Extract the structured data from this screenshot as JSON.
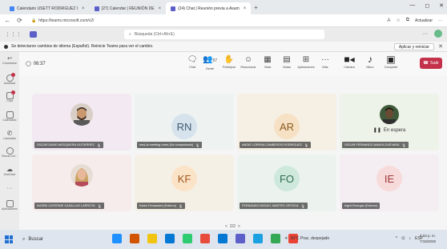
{
  "browser": {
    "tabs": [
      {
        "label": "Calendario USETT RODRIGUEZ I",
        "favicon_color": "#4285f4"
      },
      {
        "label": "(27) Calendar | REUNIÓN DE",
        "favicon_color": "#5b5fc7"
      },
      {
        "label": "(24) Chat | Reunión previa a Asam",
        "favicon_color": "#5b5fc7"
      }
    ],
    "tab_close": "×",
    "new_tab": "+",
    "window_controls": [
      "—",
      "◻",
      "✕"
    ],
    "url": "https://teams.microsoft.com/v2/",
    "update_label": "Actualizar"
  },
  "teams_header": {
    "search_placeholder": "Búsqueda (Ctrl+Alt+E)",
    "more": "···"
  },
  "banner": {
    "text": "Se detectaron cambios de idioma (Español). Reinicie Teams para ver el cambio.",
    "button": "Aplicar y reiniciar",
    "close": "✕"
  },
  "rail": {
    "items": [
      {
        "label": "Conectarse",
        "icon": "arrow-icon"
      },
      {
        "label": "Actividad",
        "icon": "bell-icon",
        "badge": true
      },
      {
        "label": "Chat",
        "icon": "chat-icon",
        "badge": true
      },
      {
        "label": "Calendario",
        "icon": "calendar-icon"
      },
      {
        "label": "Llamadas",
        "icon": "phone-icon"
      },
      {
        "label": "Bonus Dot...",
        "icon": "app-icon"
      },
      {
        "label": "OneDrive",
        "icon": "cloud-icon"
      },
      {
        "label": "···",
        "icon": "more-icon"
      },
      {
        "label": "Aplicaciones",
        "icon": "apps-icon"
      }
    ]
  },
  "meeting": {
    "timer": "06:37",
    "controls": [
      {
        "label": "Chat",
        "glyph": "🗨",
        "name": "chat-control"
      },
      {
        "label": "Gente",
        "glyph": "👥",
        "count": "57",
        "name": "people-control"
      },
      {
        "label": "Participar",
        "glyph": "✋",
        "name": "raise-control"
      },
      {
        "label": "Reaccionar",
        "glyph": "☺",
        "name": "react-control"
      },
      {
        "label": "Vista",
        "glyph": "▦",
        "name": "view-control"
      },
      {
        "label": "Notas",
        "glyph": "▤",
        "name": "notes-control"
      },
      {
        "label": "Aplicaciones",
        "glyph": "⊞",
        "name": "apps-control"
      },
      {
        "label": "Más",
        "glyph": "···",
        "name": "more-control"
      },
      {
        "label": "Cámara",
        "glyph": "📹",
        "name": "camera-control"
      },
      {
        "label": "Micro",
        "glyph": "🎙",
        "name": "mic-control"
      },
      {
        "label": "Compartir",
        "glyph": "⬆",
        "name": "share-control"
      }
    ],
    "leave_label": "Salir"
  },
  "participants": [
    {
      "name": "OSCAR DAVID MOSQUERA GUTIERREZ",
      "type": "photo",
      "bg": "#f2e9f3",
      "photo": "man-beard"
    },
    {
      "name": "med-ai meeting notes (No comprobado)",
      "type": "initials",
      "initials": "RN",
      "bg": "#eef3f1",
      "avatar_bg": "#d6e3ec",
      "avatar_fg": "#3d5a73"
    },
    {
      "name": "ANGIE LORENA CAMBEROS RODRIGUEZ",
      "type": "initials",
      "initials": "AR",
      "bg": "#f6efe4",
      "avatar_bg": "#f7e1c4",
      "avatar_fg": "#8a5a1f"
    },
    {
      "name": "OSCAR FERNANDO AMAYA GUEVARA",
      "type": "waiting",
      "waiting_label": "En espera",
      "bg": "#eef3ea",
      "photo": "man-dark"
    },
    {
      "name": "INGRID CATERINE CASALLAS LARROTA",
      "type": "photo",
      "bg": "#f6ecec",
      "photo": "woman-blonde"
    },
    {
      "name": "Karen Fernandes (Externo)",
      "type": "initials",
      "initials": "KF",
      "bg": "#f5f0e6",
      "avatar_bg": "#fbe3c8",
      "avatar_fg": "#a0581a"
    },
    {
      "name": "FERNANDO MIGUEL MARTES ORTEGA",
      "type": "initials",
      "initials": "FO",
      "bg": "#ecf3ef",
      "avatar_bg": "#cfe8dc",
      "avatar_fg": "#2d6b4f"
    },
    {
      "name": "Ingrid Energas (Externo)",
      "type": "initials",
      "initials": "IE",
      "bg": "#f4eef3",
      "avatar_bg": "#f7dada",
      "avatar_fg": "#a03a3a"
    }
  ],
  "pager": {
    "prev": "<",
    "text": "2/2",
    "next": ">"
  },
  "taskbar": {
    "search_label": "Buscar",
    "weather": "30°C Prac. despejado",
    "tray": "ESP",
    "time": "5:03 p. m.",
    "date": "7/18/2025",
    "apps": [
      "#1e90ff",
      "#d35400",
      "#f1c40f",
      "#0078d4",
      "#2ecc71",
      "#e74c3c",
      "#0078d4",
      "#5b5fc7",
      "#1ba1e2",
      "#34a853",
      "#ea4335"
    ]
  }
}
